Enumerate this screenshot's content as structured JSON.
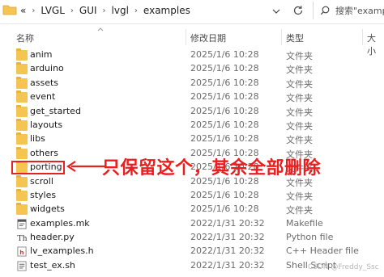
{
  "address": {
    "prefix": "«",
    "crumbs": [
      "LVGL",
      "GUI",
      "lvgl",
      "examples"
    ],
    "search_placeholder": "搜索\"exampl"
  },
  "columns": {
    "name": "名称",
    "date": "修改日期",
    "type": "类型",
    "size": "大小"
  },
  "files": [
    {
      "name": "anim",
      "date": "2025/1/6 10:28",
      "type": "文件夹",
      "icon": "folder-icon"
    },
    {
      "name": "arduino",
      "date": "2025/1/6 10:28",
      "type": "文件夹",
      "icon": "folder-icon"
    },
    {
      "name": "assets",
      "date": "2025/1/6 10:28",
      "type": "文件夹",
      "icon": "folder-icon"
    },
    {
      "name": "event",
      "date": "2025/1/6 10:28",
      "type": "文件夹",
      "icon": "folder-icon"
    },
    {
      "name": "get_started",
      "date": "2025/1/6 10:28",
      "type": "文件夹",
      "icon": "folder-icon"
    },
    {
      "name": "layouts",
      "date": "2025/1/6 10:28",
      "type": "文件夹",
      "icon": "folder-icon"
    },
    {
      "name": "libs",
      "date": "2025/1/6 10:28",
      "type": "文件夹",
      "icon": "folder-icon"
    },
    {
      "name": "others",
      "date": "2025/1/6 10:28",
      "type": "文件夹",
      "icon": "folder-icon"
    },
    {
      "name": "porting",
      "date": "2025/1/6 10:28",
      "type": "文件夹",
      "icon": "folder-icon"
    },
    {
      "name": "scroll",
      "date": "2025/1/6 10:28",
      "type": "文件夹",
      "icon": "folder-icon"
    },
    {
      "name": "styles",
      "date": "2025/1/6 10:28",
      "type": "文件夹",
      "icon": "folder-icon"
    },
    {
      "name": "widgets",
      "date": "2025/1/6 10:28",
      "type": "文件夹",
      "icon": "folder-icon"
    },
    {
      "name": "examples.mk",
      "date": "2022/1/31 20:32",
      "type": "Makefile",
      "icon": "makefile-icon"
    },
    {
      "name": "header.py",
      "date": "2022/1/31 20:32",
      "type": "Python file",
      "icon": "python-file-icon"
    },
    {
      "name": "lv_examples.h",
      "date": "2022/1/31 20:32",
      "type": "C++ Header file",
      "icon": "header-file-icon"
    },
    {
      "name": "test_ex.sh",
      "date": "2022/1/31 20:32",
      "type": "Shell Script",
      "icon": "shell-script-icon"
    }
  ],
  "annotation": {
    "text": "只保留这个，其余全部删除",
    "color": "#ee1c1c"
  },
  "watermark": "CSDN @Freddy_Ssc"
}
